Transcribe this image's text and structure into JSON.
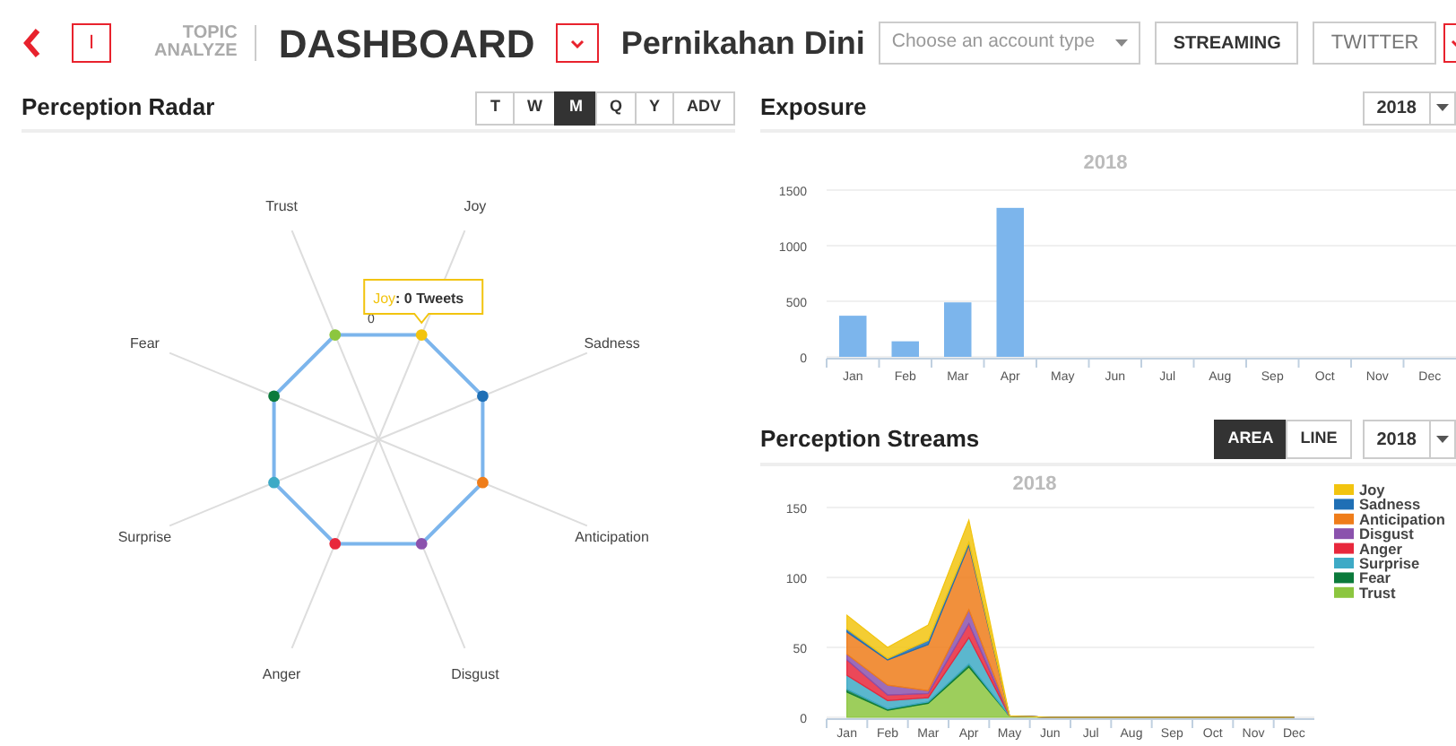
{
  "header": {
    "box_letter": "I",
    "brand_top": "TOPIC",
    "brand_bottom": "ANALYZE",
    "title": "DASHBOARD",
    "topic": "Pernikahan Dini",
    "account_select": {
      "placeholder": "Choose an account type"
    },
    "buttons": [
      "STREAMING",
      "TWITTER"
    ]
  },
  "radar_panel": {
    "title": "Perception Radar",
    "periods": [
      {
        "label": "T",
        "selected": false
      },
      {
        "label": "W",
        "selected": false
      },
      {
        "label": "M",
        "selected": true
      },
      {
        "label": "Q",
        "selected": false
      },
      {
        "label": "Y",
        "selected": false
      },
      {
        "label": "ADV",
        "selected": false
      }
    ],
    "axes": [
      {
        "label": "Joy",
        "color": "#f2c40f"
      },
      {
        "label": "Sadness",
        "color": "#1f6fb5"
      },
      {
        "label": "Anticipation",
        "color": "#ef7d1a"
      },
      {
        "label": "Disgust",
        "color": "#8b52ad"
      },
      {
        "label": "Anger",
        "color": "#e8283c"
      },
      {
        "label": "Surprise",
        "color": "#3eaac6"
      },
      {
        "label": "Fear",
        "color": "#0b7a3b"
      },
      {
        "label": "Trust",
        "color": "#8cc63f"
      }
    ],
    "tick_label": "0",
    "tooltip": {
      "label": "Joy",
      "color": "#f2c40f",
      "value": ": 0 Tweets"
    }
  },
  "exposure": {
    "title": "Exposure",
    "year_select": "2018",
    "chart_data": {
      "type": "bar",
      "title": "2018",
      "categories": [
        "Jan",
        "Feb",
        "Mar",
        "Apr",
        "May",
        "Jun",
        "Jul",
        "Aug",
        "Sep",
        "Oct",
        "Nov",
        "Dec"
      ],
      "values": [
        370,
        140,
        490,
        1340,
        0,
        0,
        0,
        0,
        0,
        0,
        0,
        0
      ],
      "ylim": [
        0,
        1500
      ],
      "yticks": [
        0,
        500,
        1000,
        1500
      ]
    }
  },
  "streams": {
    "title": "Perception Streams",
    "modes": [
      {
        "label": "AREA",
        "selected": true
      },
      {
        "label": "LINE",
        "selected": false
      }
    ],
    "year_select": "2018",
    "chart_data": {
      "type": "area",
      "title": "2018",
      "stacked": true,
      "categories": [
        "Jan",
        "Feb",
        "Mar",
        "Apr",
        "May",
        "Jun",
        "Jul",
        "Aug",
        "Sep",
        "Oct",
        "Nov",
        "Dec"
      ],
      "ylim": [
        0,
        150
      ],
      "yticks": [
        0,
        50,
        100,
        150
      ],
      "legend": "right",
      "series": [
        {
          "name": "Joy",
          "color": "#f2c40f",
          "values": [
            10,
            8,
            11,
            16,
            0,
            0,
            0,
            0,
            0,
            0,
            0,
            0
          ]
        },
        {
          "name": "Sadness",
          "color": "#1f6fb5",
          "values": [
            2,
            1,
            3,
            2,
            0,
            0,
            0,
            0,
            0,
            0,
            0,
            0
          ]
        },
        {
          "name": "Anticipation",
          "color": "#ef7d1a",
          "values": [
            16,
            18,
            33,
            46,
            0,
            0,
            0,
            0,
            0,
            0,
            0,
            0
          ]
        },
        {
          "name": "Disgust",
          "color": "#8b52ad",
          "values": [
            4,
            7,
            2,
            10,
            0,
            0,
            0,
            0,
            0,
            0,
            0,
            0
          ]
        },
        {
          "name": "Anger",
          "color": "#e8283c",
          "values": [
            11,
            4,
            3,
            10,
            0,
            0,
            0,
            0,
            0,
            0,
            0,
            0
          ]
        },
        {
          "name": "Surprise",
          "color": "#3eaac6",
          "values": [
            10,
            6,
            3,
            19,
            0,
            0,
            0,
            0,
            0,
            0,
            0,
            0
          ]
        },
        {
          "name": "Fear",
          "color": "#0b7a3b",
          "values": [
            2,
            1,
            1,
            2,
            0,
            0,
            0,
            0,
            0,
            0,
            0,
            0
          ]
        },
        {
          "name": "Trust",
          "color": "#8cc63f",
          "values": [
            18,
            5,
            10,
            36,
            1,
            0,
            0,
            0,
            0,
            0,
            0,
            0
          ]
        }
      ]
    }
  }
}
